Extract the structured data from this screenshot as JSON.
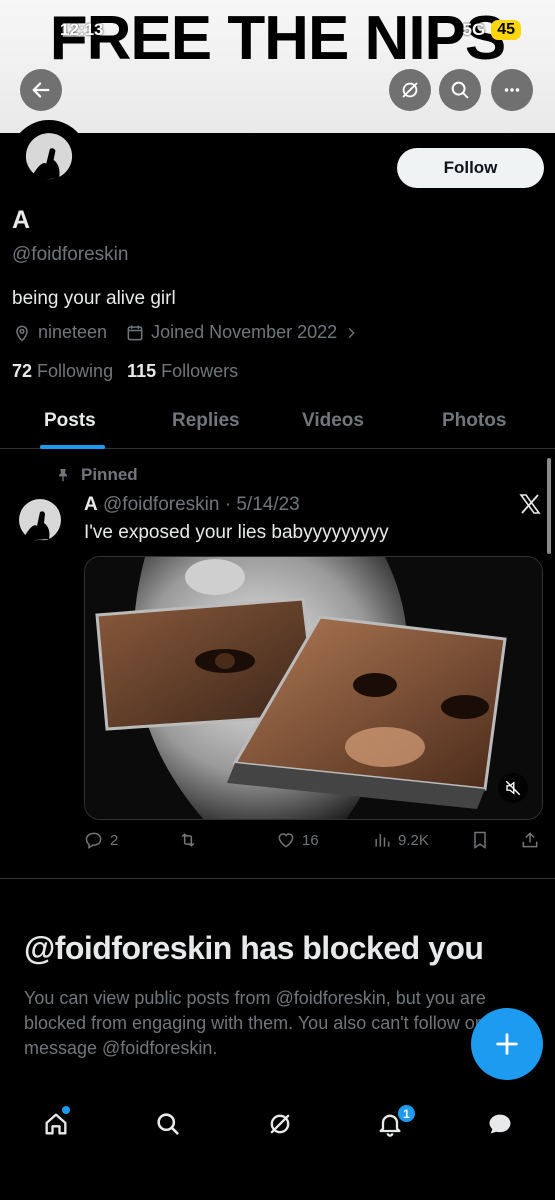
{
  "banner": {
    "text": "FREE THE NIPS"
  },
  "status_bar": {
    "time": "12:13",
    "signal": "5G",
    "battery": "45"
  },
  "header": {
    "back_icon": "arrow-left-icon",
    "grok_icon": "grok-icon",
    "search_icon": "search-icon",
    "more_icon": "more-icon"
  },
  "profile": {
    "display_name": "A",
    "handle": "@foidforeskin",
    "bio": "being your alive girl",
    "location": "nineteen",
    "joined": "Joined November 2022",
    "following_count": "72",
    "following_label": "Following",
    "followers_count": "115",
    "followers_label": "Followers",
    "follow_button": "Follow"
  },
  "tabs": [
    {
      "label": "Posts",
      "active": true
    },
    {
      "label": "Replies",
      "active": false
    },
    {
      "label": "Videos",
      "active": false
    },
    {
      "label": "Photos",
      "active": false
    }
  ],
  "post": {
    "pinned_label": "Pinned",
    "author": "A",
    "handle": "@foidforeskin",
    "separator": "·",
    "date": "5/14/23",
    "text": "I've exposed your lies babyyyyyyyyy",
    "replies": "2",
    "reposts": "",
    "likes": "16",
    "views": "9.2K"
  },
  "blocked": {
    "title": "@foidforeskin has blocked you",
    "body": "You can view public posts from @foidforeskin, but you are blocked from engaging with them. You also can't follow or message @foidforeskin."
  },
  "nav": {
    "notifications_badge": "1"
  },
  "colors": {
    "accent": "#1d9bf0",
    "muted": "#71767b",
    "text": "#e7e9ea",
    "border": "#2f3336"
  }
}
